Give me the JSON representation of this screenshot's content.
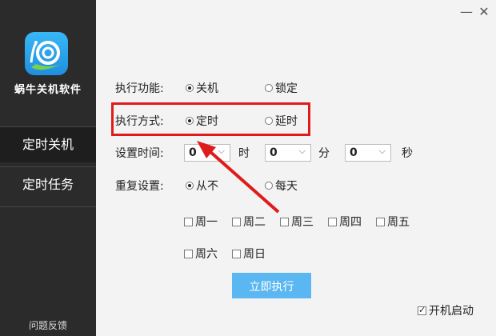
{
  "sidebar": {
    "app_name": "蜗牛关机软件",
    "nav": [
      {
        "label": "定时关机",
        "active": true
      },
      {
        "label": "定时任务",
        "active": false
      }
    ],
    "feedback": "问题反馈"
  },
  "window": {
    "minimize_icon": "—",
    "close_icon": "✕"
  },
  "form": {
    "function": {
      "label": "执行功能:",
      "options": [
        {
          "label": "关机",
          "selected": true
        },
        {
          "label": "锁定",
          "selected": false
        }
      ]
    },
    "mode": {
      "label": "执行方式:",
      "options": [
        {
          "label": "定时",
          "selected": true
        },
        {
          "label": "延时",
          "selected": false
        }
      ]
    },
    "time": {
      "label": "设置时间:",
      "hour": {
        "value": "0",
        "unit": "时"
      },
      "minute": {
        "value": "0",
        "unit": "分"
      },
      "second": {
        "value": "0",
        "unit": "秒"
      }
    },
    "repeat": {
      "label": "重复设置:",
      "options": [
        {
          "label": "从不",
          "selected": true
        },
        {
          "label": "每天",
          "selected": false
        }
      ],
      "days": [
        "周一",
        "周二",
        "周三",
        "周四",
        "周五",
        "周六",
        "周日"
      ]
    },
    "run_button": "立即执行",
    "autostart": {
      "label": "开机启动",
      "checked": true
    }
  },
  "colors": {
    "sidebar_bg": "#2b2b2b",
    "sidebar_active": "#1e1e1e",
    "content_bg": "#f3f3f3",
    "run_button": "#5ab7f2",
    "annotation_red": "#e01b1b"
  },
  "icons": {
    "logo": "snail-logo-icon",
    "dropdown": "chevron-down-icon",
    "annotation": "red-arrow-icon"
  }
}
